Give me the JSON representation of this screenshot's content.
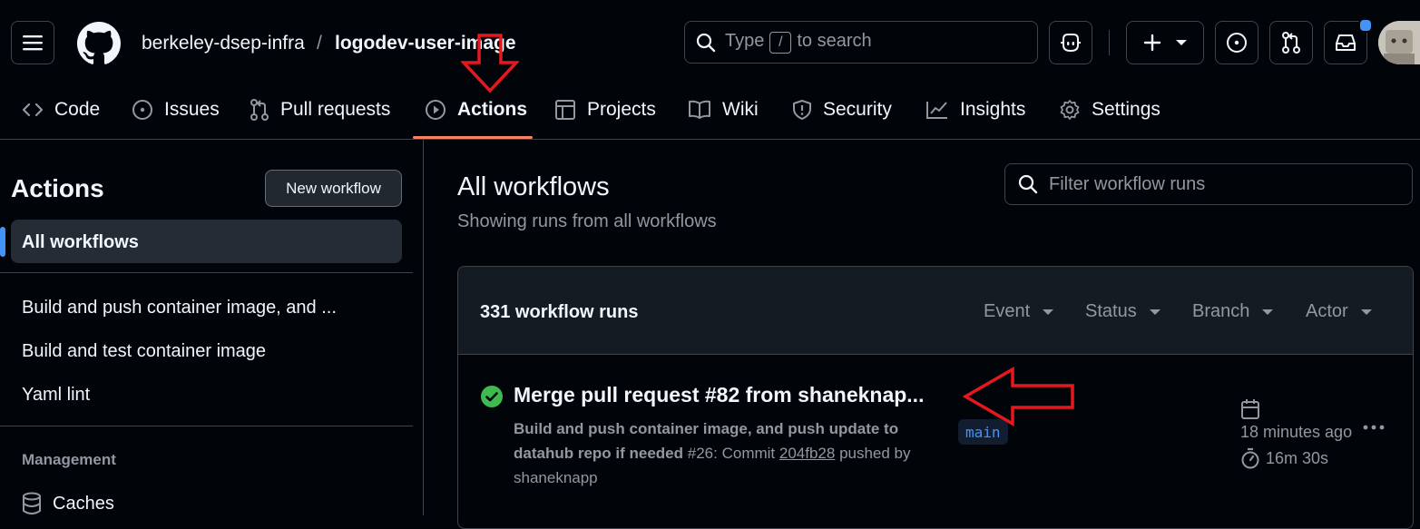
{
  "header": {
    "owner": "berkeley-dsep-infra",
    "separator": "/",
    "repo": "logodev-user-image",
    "search": {
      "prefix": "Type",
      "key": "/",
      "suffix": "to search"
    }
  },
  "nav": {
    "tabs": [
      {
        "label": "Code",
        "icon": "code-icon"
      },
      {
        "label": "Issues",
        "icon": "issue-opened-icon"
      },
      {
        "label": "Pull requests",
        "icon": "git-pull-request-icon"
      },
      {
        "label": "Actions",
        "icon": "play-icon",
        "active": true
      },
      {
        "label": "Projects",
        "icon": "table-icon"
      },
      {
        "label": "Wiki",
        "icon": "book-icon"
      },
      {
        "label": "Security",
        "icon": "shield-icon"
      },
      {
        "label": "Insights",
        "icon": "graph-icon"
      },
      {
        "label": "Settings",
        "icon": "gear-icon"
      }
    ]
  },
  "sidebar": {
    "title": "Actions",
    "new_workflow": "New workflow",
    "selected": "All workflows",
    "workflows": [
      "Build and push container image, and ...",
      "Build and test container image",
      "Yaml lint"
    ],
    "management_heading": "Management",
    "caches": "Caches"
  },
  "main": {
    "title": "All workflows",
    "subtitle": "Showing runs from all workflows",
    "filter_placeholder": "Filter workflow runs",
    "runs_count": "331 workflow runs",
    "filters": [
      "Event",
      "Status",
      "Branch",
      "Actor"
    ],
    "run": {
      "title": "Merge pull request #82 from shaneknap...",
      "workflow_name": "Build and push container image, and push update to datahub repo if needed",
      "run_number": "#26",
      "commit_label": ": Commit",
      "commit_sha": "204fb28",
      "pushed_by": "pushed by",
      "actor": "shaneknapp",
      "branch": "main",
      "time_ago": "18 minutes ago",
      "duration": "16m 30s",
      "status": "success"
    }
  },
  "colors": {
    "background": "#010409",
    "accent": "#4493f8",
    "success": "#3fb950",
    "annotation_arrow": "#e5191d",
    "tab_underline": "#f78166"
  }
}
